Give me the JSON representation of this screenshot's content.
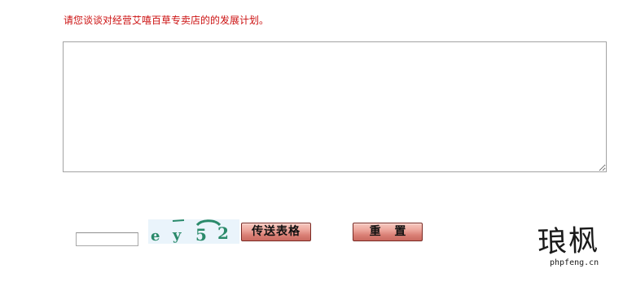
{
  "form": {
    "prompt": "请您谈谈对经营艾嘻百草专卖店的的发展计划。",
    "plan_value": "",
    "captcha_value": "",
    "captcha_text": "ey52",
    "submit_label": "传送表格",
    "reset_label": "重 置"
  },
  "watermark": {
    "chars": "琅枫",
    "domain": "phpfeng.cn"
  },
  "colors": {
    "prompt_text": "#cc1111",
    "captcha_text": "#2a8a6a",
    "captcha_bg": "#eaf4fb",
    "button_fill": "#e39a90"
  }
}
